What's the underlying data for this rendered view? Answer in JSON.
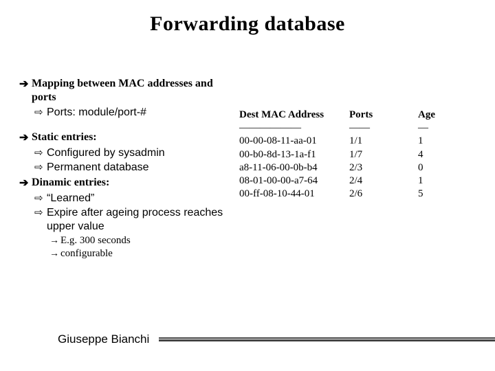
{
  "title": "Forwarding database",
  "bullets": {
    "mapping": "Mapping between MAC addresses and ports",
    "mapping_sub": "Ports: module/port-#",
    "static": "Static entries:",
    "static_sub1": "Configured by sysadmin",
    "static_sub2": "Permanent database",
    "dynamic": "Dinamic entries:",
    "dynamic_sub1": "“Learned”",
    "dynamic_sub2": "Expire after ageing process reaches upper value",
    "dynamic_sub2a": "E.g. 300 seconds",
    "dynamic_sub2b": "configurable"
  },
  "table": {
    "headers": {
      "mac": "Dest MAC Address",
      "ports": "Ports",
      "age": "Age"
    },
    "sep": {
      "mac": "——————",
      "ports": "——",
      "age": "—"
    },
    "rows": [
      {
        "mac": "00-00-08-11-aa-01",
        "ports": "1/1",
        "age": "1"
      },
      {
        "mac": "00-b0-8d-13-1a-f1",
        "ports": "1/7",
        "age": "4"
      },
      {
        "mac": "a8-11-06-00-0b-b4",
        "ports": "2/3",
        "age": "0"
      },
      {
        "mac": "08-01-00-00-a7-64",
        "ports": "2/4",
        "age": "1"
      },
      {
        "mac": "00-ff-08-10-44-01",
        "ports": "2/6",
        "age": "5"
      }
    ]
  },
  "footer": {
    "author": "Giuseppe Bianchi"
  }
}
